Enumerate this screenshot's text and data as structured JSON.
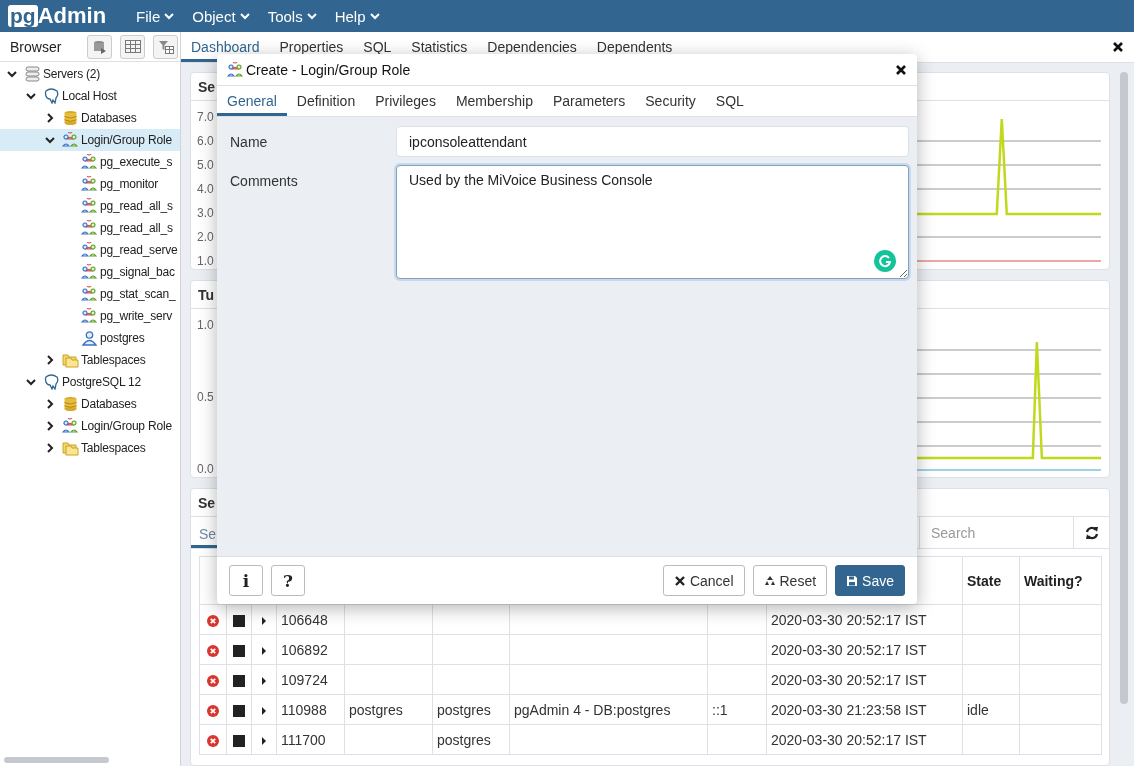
{
  "app": {
    "logo_badge": "pg",
    "logo_text": "Admin"
  },
  "menu": [
    {
      "label": "File"
    },
    {
      "label": "Object"
    },
    {
      "label": "Tools"
    },
    {
      "label": "Help"
    }
  ],
  "browser": {
    "title": "Browser"
  },
  "tree": [
    {
      "label": "Servers (2)",
      "kind": "servers",
      "expanded": true,
      "selected": false,
      "children": [
        {
          "label": "Local Host",
          "kind": "server",
          "expanded": true,
          "selected": false,
          "children": [
            {
              "label": "Databases",
              "kind": "databases",
              "expanded": false,
              "selected": false
            },
            {
              "label": "Login/Group Role",
              "kind": "roles",
              "expanded": true,
              "selected": true,
              "children": [
                {
                  "label": "pg_execute_s",
                  "kind": "role",
                  "selected": false
                },
                {
                  "label": "pg_monitor",
                  "kind": "role",
                  "selected": false
                },
                {
                  "label": "pg_read_all_s",
                  "kind": "role",
                  "selected": false
                },
                {
                  "label": "pg_read_all_s",
                  "kind": "role",
                  "selected": false
                },
                {
                  "label": "pg_read_serve",
                  "kind": "role",
                  "selected": false
                },
                {
                  "label": "pg_signal_bac",
                  "kind": "role",
                  "selected": false
                },
                {
                  "label": "pg_stat_scan_",
                  "kind": "role",
                  "selected": false
                },
                {
                  "label": "pg_write_serv",
                  "kind": "role",
                  "selected": false
                },
                {
                  "label": "postgres",
                  "kind": "login",
                  "selected": false
                }
              ]
            },
            {
              "label": "Tablespaces",
              "kind": "tablespaces",
              "expanded": false,
              "selected": false
            }
          ]
        },
        {
          "label": "PostgreSQL 12",
          "kind": "server",
          "expanded": true,
          "selected": false,
          "children": [
            {
              "label": "Databases",
              "kind": "databases",
              "expanded": false,
              "selected": false
            },
            {
              "label": "Login/Group Role",
              "kind": "roles",
              "expanded": false,
              "selected": false
            },
            {
              "label": "Tablespaces",
              "kind": "tablespaces",
              "expanded": false,
              "selected": false
            }
          ]
        }
      ]
    }
  ],
  "tabs": [
    {
      "label": "Dashboard",
      "selected": true
    },
    {
      "label": "Properties",
      "selected": false
    },
    {
      "label": "SQL",
      "selected": false
    },
    {
      "label": "Statistics",
      "selected": false
    },
    {
      "label": "Dependencies",
      "selected": false
    },
    {
      "label": "Dependents",
      "selected": false
    }
  ],
  "panels": [
    {
      "title": "Se",
      "y_labels": [
        "7.0",
        "6.0",
        "5.0",
        "4.0",
        "3.0",
        "2.0",
        "1.0"
      ]
    },
    {
      "title": "Tu",
      "y_labels": [
        "1.0",
        "0.5",
        "0.0"
      ]
    }
  ],
  "sessions": {
    "title": "Se",
    "subtab": {
      "label": "Se",
      "selected": true
    },
    "search": {
      "placeholder": "Search"
    },
    "columns": [
      "State",
      "Waiting?"
    ],
    "rows": [
      {
        "column_4": "106648",
        "column_9": "2020-03-30 20:52:17 IST"
      },
      {
        "column_4": "106892",
        "column_9": "2020-03-30 20:52:17 IST"
      },
      {
        "column_4": "109724",
        "column_9": "2020-03-30 20:52:17 IST"
      },
      {
        "column_4": "110988",
        "column_5": "postgres",
        "column_6": "postgres",
        "column_7": "pgAdmin 4 - DB:postgres",
        "column_8": "::1",
        "column_9": "2020-03-30 21:23:58 IST",
        "column_10": "idle"
      },
      {
        "column_4": "111700",
        "column_6": "postgres",
        "column_9": "2020-03-30 20:52:17 IST"
      }
    ]
  },
  "dialog": {
    "title": "Create - Login/Group Role",
    "tabs": [
      {
        "label": "General",
        "selected": true
      },
      {
        "label": "Definition",
        "selected": false
      },
      {
        "label": "Privileges",
        "selected": false
      },
      {
        "label": "Membership",
        "selected": false
      },
      {
        "label": "Parameters",
        "selected": false
      },
      {
        "label": "Security",
        "selected": false
      },
      {
        "label": "SQL",
        "selected": false
      }
    ],
    "fields": [
      {
        "kind": "input",
        "label": "Name",
        "value": "ipconsoleattendant",
        "focused": false
      },
      {
        "kind": "textarea",
        "label": "Comments",
        "value": "Used by the MiVoice Business Console",
        "focused": true
      }
    ],
    "help_buttons": [
      {
        "label": "i"
      },
      {
        "label": "?"
      }
    ],
    "buttons": [
      {
        "kind": "cancel",
        "label": "Cancel"
      },
      {
        "kind": "reset",
        "label": "Reset"
      },
      {
        "kind": "save",
        "label": "Save"
      }
    ]
  }
}
